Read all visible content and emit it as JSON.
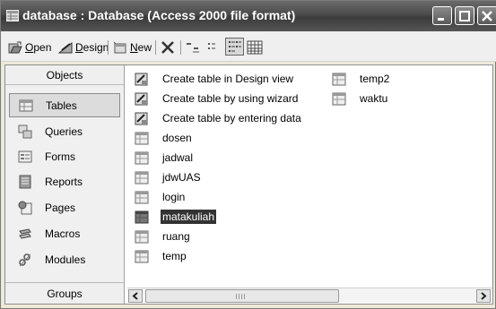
{
  "window": {
    "title": "database : Database (Access 2000 file format)"
  },
  "toolbar": {
    "open_label": "Open",
    "open_mnemonic": "O",
    "open_rest": "pen",
    "design_label": "Design",
    "design_mnemonic": "D",
    "design_rest": "esign",
    "new_label": "New",
    "new_mnemonic": "N",
    "new_rest": "ew"
  },
  "objects": {
    "header": "Objects",
    "items": [
      {
        "label": "Tables",
        "icon": "table-icon",
        "selected": true
      },
      {
        "label": "Queries",
        "icon": "query-icon",
        "selected": false
      },
      {
        "label": "Forms",
        "icon": "form-icon",
        "selected": false
      },
      {
        "label": "Reports",
        "icon": "report-icon",
        "selected": false
      },
      {
        "label": "Pages",
        "icon": "page-icon",
        "selected": false
      },
      {
        "label": "Macros",
        "icon": "macro-icon",
        "selected": false
      },
      {
        "label": "Modules",
        "icon": "module-icon",
        "selected": false
      }
    ],
    "groups_label": "Groups"
  },
  "list": {
    "column1": [
      {
        "label": "Create table in Design view",
        "icon": "wizard-icon"
      },
      {
        "label": "Create table by using wizard",
        "icon": "wizard-icon"
      },
      {
        "label": "Create table by entering data",
        "icon": "wizard-icon"
      },
      {
        "label": "dosen",
        "icon": "table-icon"
      },
      {
        "label": "jadwal",
        "icon": "table-icon"
      },
      {
        "label": "jdwUAS",
        "icon": "table-icon"
      },
      {
        "label": "login",
        "icon": "table-icon"
      },
      {
        "label": "matakuliah",
        "icon": "table-icon",
        "selected": true
      },
      {
        "label": "ruang",
        "icon": "table-icon"
      },
      {
        "label": "temp",
        "icon": "table-icon"
      }
    ],
    "column2": [
      {
        "label": "temp2",
        "icon": "table-icon"
      },
      {
        "label": "waktu",
        "icon": "table-icon"
      }
    ]
  },
  "colors": {
    "titlebar": "#4a4a4a",
    "selection": "#333333",
    "panel": "#f0f0f0"
  }
}
